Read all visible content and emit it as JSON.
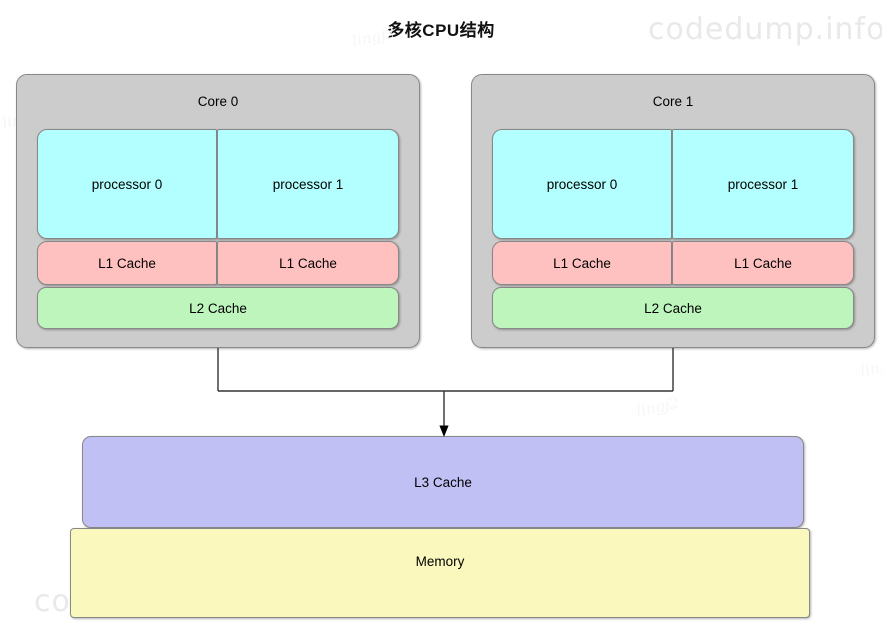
{
  "title": "多核CPU结构",
  "watermarks": {
    "top_right": "codedump.info",
    "bottom_left": "codedump.info",
    "tile": "lingj2"
  },
  "colors": {
    "core": "#cccccc",
    "processor": "#b3ffff",
    "l1": "#ffc0c0",
    "l2": "#bdf5bd",
    "l3": "#c0c0f5",
    "memory": "#faf8bc",
    "stroke": "#888888",
    "connector": "#333333",
    "background": "#ffffff"
  },
  "diagram": {
    "cores": [
      {
        "label": "Core 0",
        "processors": [
          "processor 0",
          "processor 1"
        ],
        "l1_caches": [
          "L1 Cache",
          "L1 Cache"
        ],
        "l2_cache": "L2 Cache"
      },
      {
        "label": "Core 1",
        "processors": [
          "processor 0",
          "processor 1"
        ],
        "l1_caches": [
          "L1 Cache",
          "L1 Cache"
        ],
        "l2_cache": "L2 Cache"
      }
    ],
    "shared": {
      "l3_cache": "L3 Cache",
      "memory": "Memory"
    }
  }
}
